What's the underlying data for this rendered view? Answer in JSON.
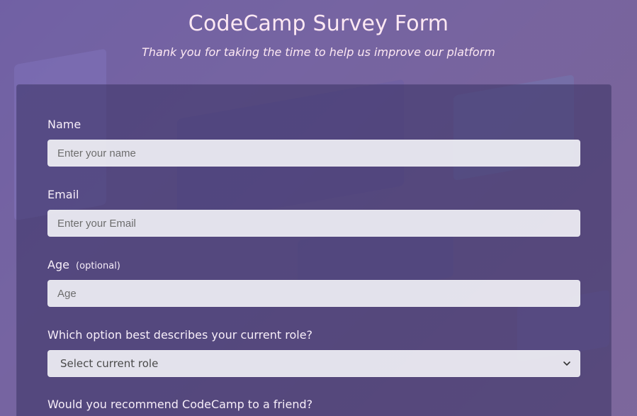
{
  "header": {
    "title": "CodeCamp Survey Form",
    "subtitle": "Thank you for taking the time to help us improve our platform"
  },
  "form": {
    "name": {
      "label": "Name",
      "placeholder": "Enter your name"
    },
    "email": {
      "label": "Email",
      "placeholder": "Enter your Email"
    },
    "age": {
      "label": "Age",
      "optional": "(optional)",
      "placeholder": "Age"
    },
    "role": {
      "label": "Which option best describes your current role?",
      "selected": "Select current role"
    },
    "recommend": {
      "label": "Would you recommend CodeCamp to a friend?"
    }
  },
  "icons": {
    "select_chevron": "chevron-down-icon"
  },
  "colors": {
    "title_text": "#fde8f3",
    "panel_bg": "#383262",
    "input_bg": "#f0f0f5"
  }
}
